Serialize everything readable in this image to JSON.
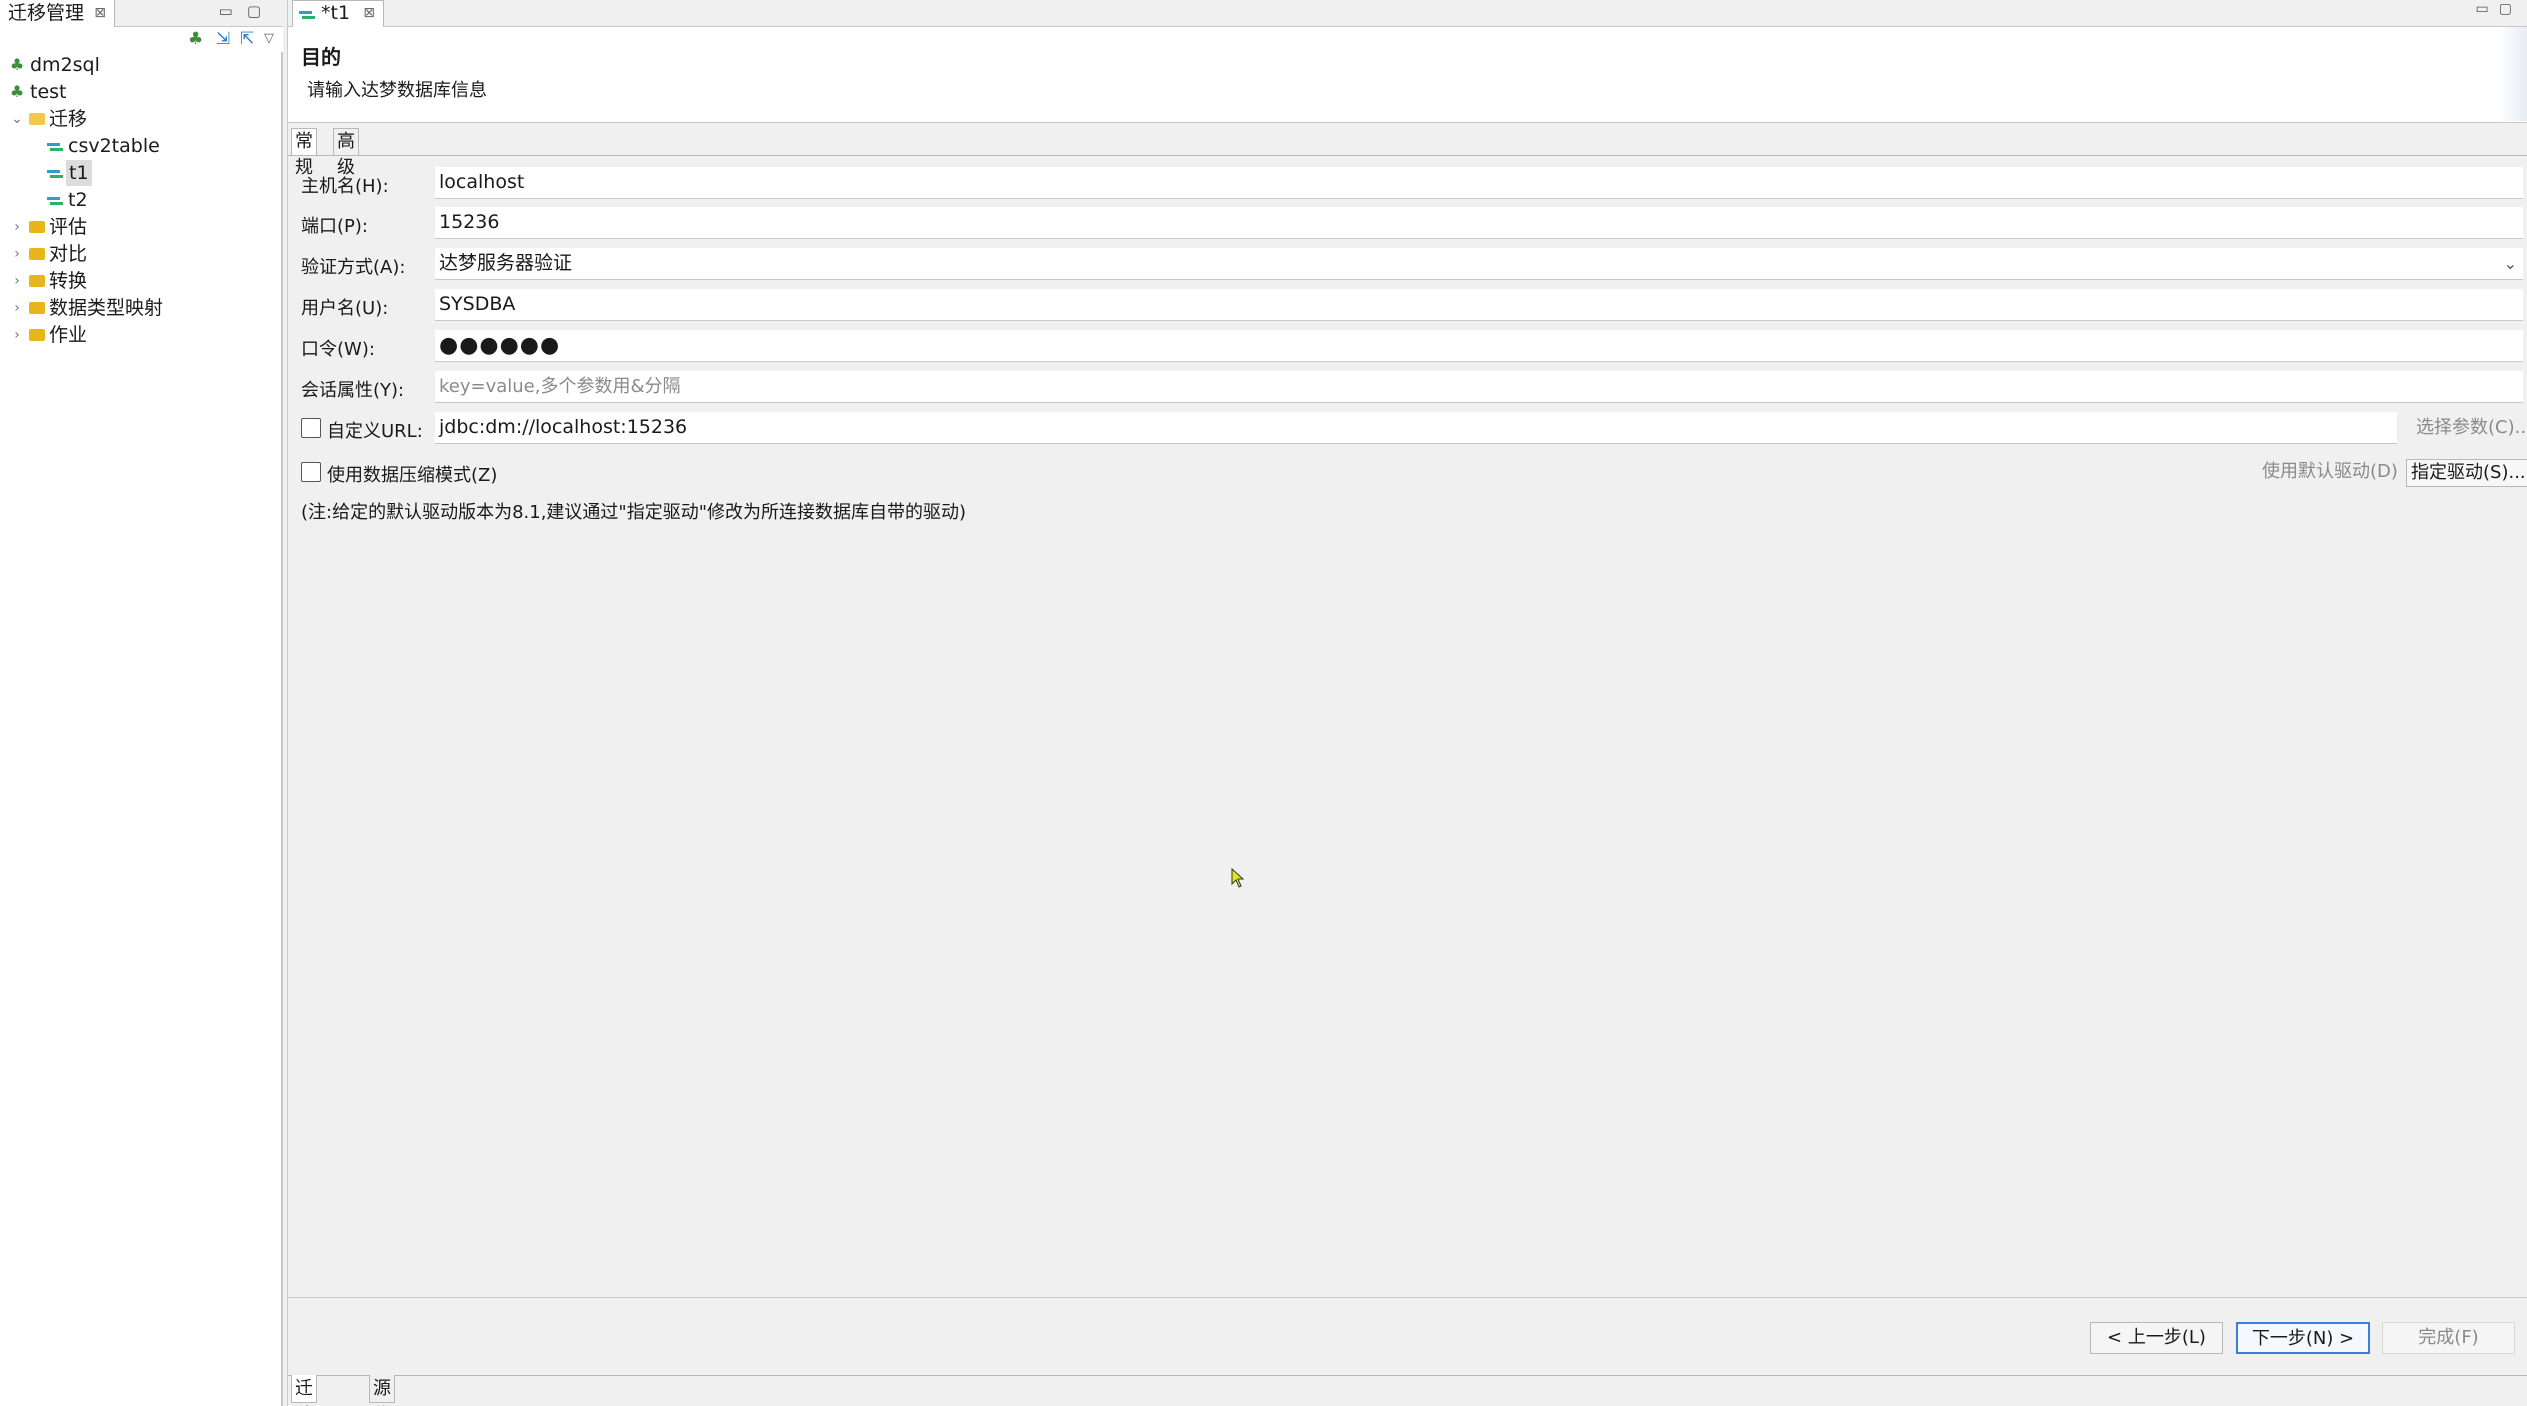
{
  "left_panel": {
    "tab_title": "迁移管理",
    "close_glyph": "⊠",
    "window_buttons": "▭▢",
    "tree": {
      "conn_dm2sql": "dm2sql",
      "conn_test": "test",
      "folder_migration": "迁移",
      "item_csv2table": "csv2table",
      "item_t1": "t1",
      "item_t2": "t2",
      "folder_evaluate": "评估",
      "folder_compare": "对比",
      "folder_convert": "转换",
      "folder_typemap": "数据类型映射",
      "folder_job": "作业"
    }
  },
  "editor": {
    "tab_title": "*t1",
    "close_glyph": "⊠",
    "window_buttons": "▭▢",
    "header": {
      "title": "目的",
      "subtitle": "请输入达梦数据库信息"
    },
    "subtabs": {
      "general": "常规",
      "advanced": "高级"
    },
    "form": {
      "host_label": "主机名(H):",
      "host_value": "localhost",
      "port_label": "端口(P):",
      "port_value": "15236",
      "auth_label": "验证方式(A):",
      "auth_value": "达梦服务器验证",
      "user_label": "用户名(U):",
      "user_value": "SYSDBA",
      "password_label": "口令(W):",
      "password_value": "●●●●●●",
      "session_label": "会话属性(Y):",
      "session_placeholder": "key=value,多个参数用&分隔",
      "custom_url_label": "自定义URL:",
      "custom_url_value": "jdbc:dm://localhost:15236",
      "select_params_button": "选择参数(C)...",
      "compress_label": "使用数据压缩模式(Z)",
      "default_driver_button": "使用默认驱动(D)",
      "specify_driver_button": "指定驱动(S)...",
      "note": "(注:给定的默认驱动版本为8.1,建议通过\"指定驱动\"修改为所连接数据库自带的驱动)"
    },
    "nav": {
      "back": "< 上一步(L)",
      "next": "下一步(N) >",
      "finish": "完成(F)"
    },
    "bottom_tabs": {
      "wizard": "迁移向导",
      "source": "源代码"
    }
  },
  "colors": {
    "primary_button_border": "#3c7fd6",
    "folder": "#e8b61a"
  }
}
